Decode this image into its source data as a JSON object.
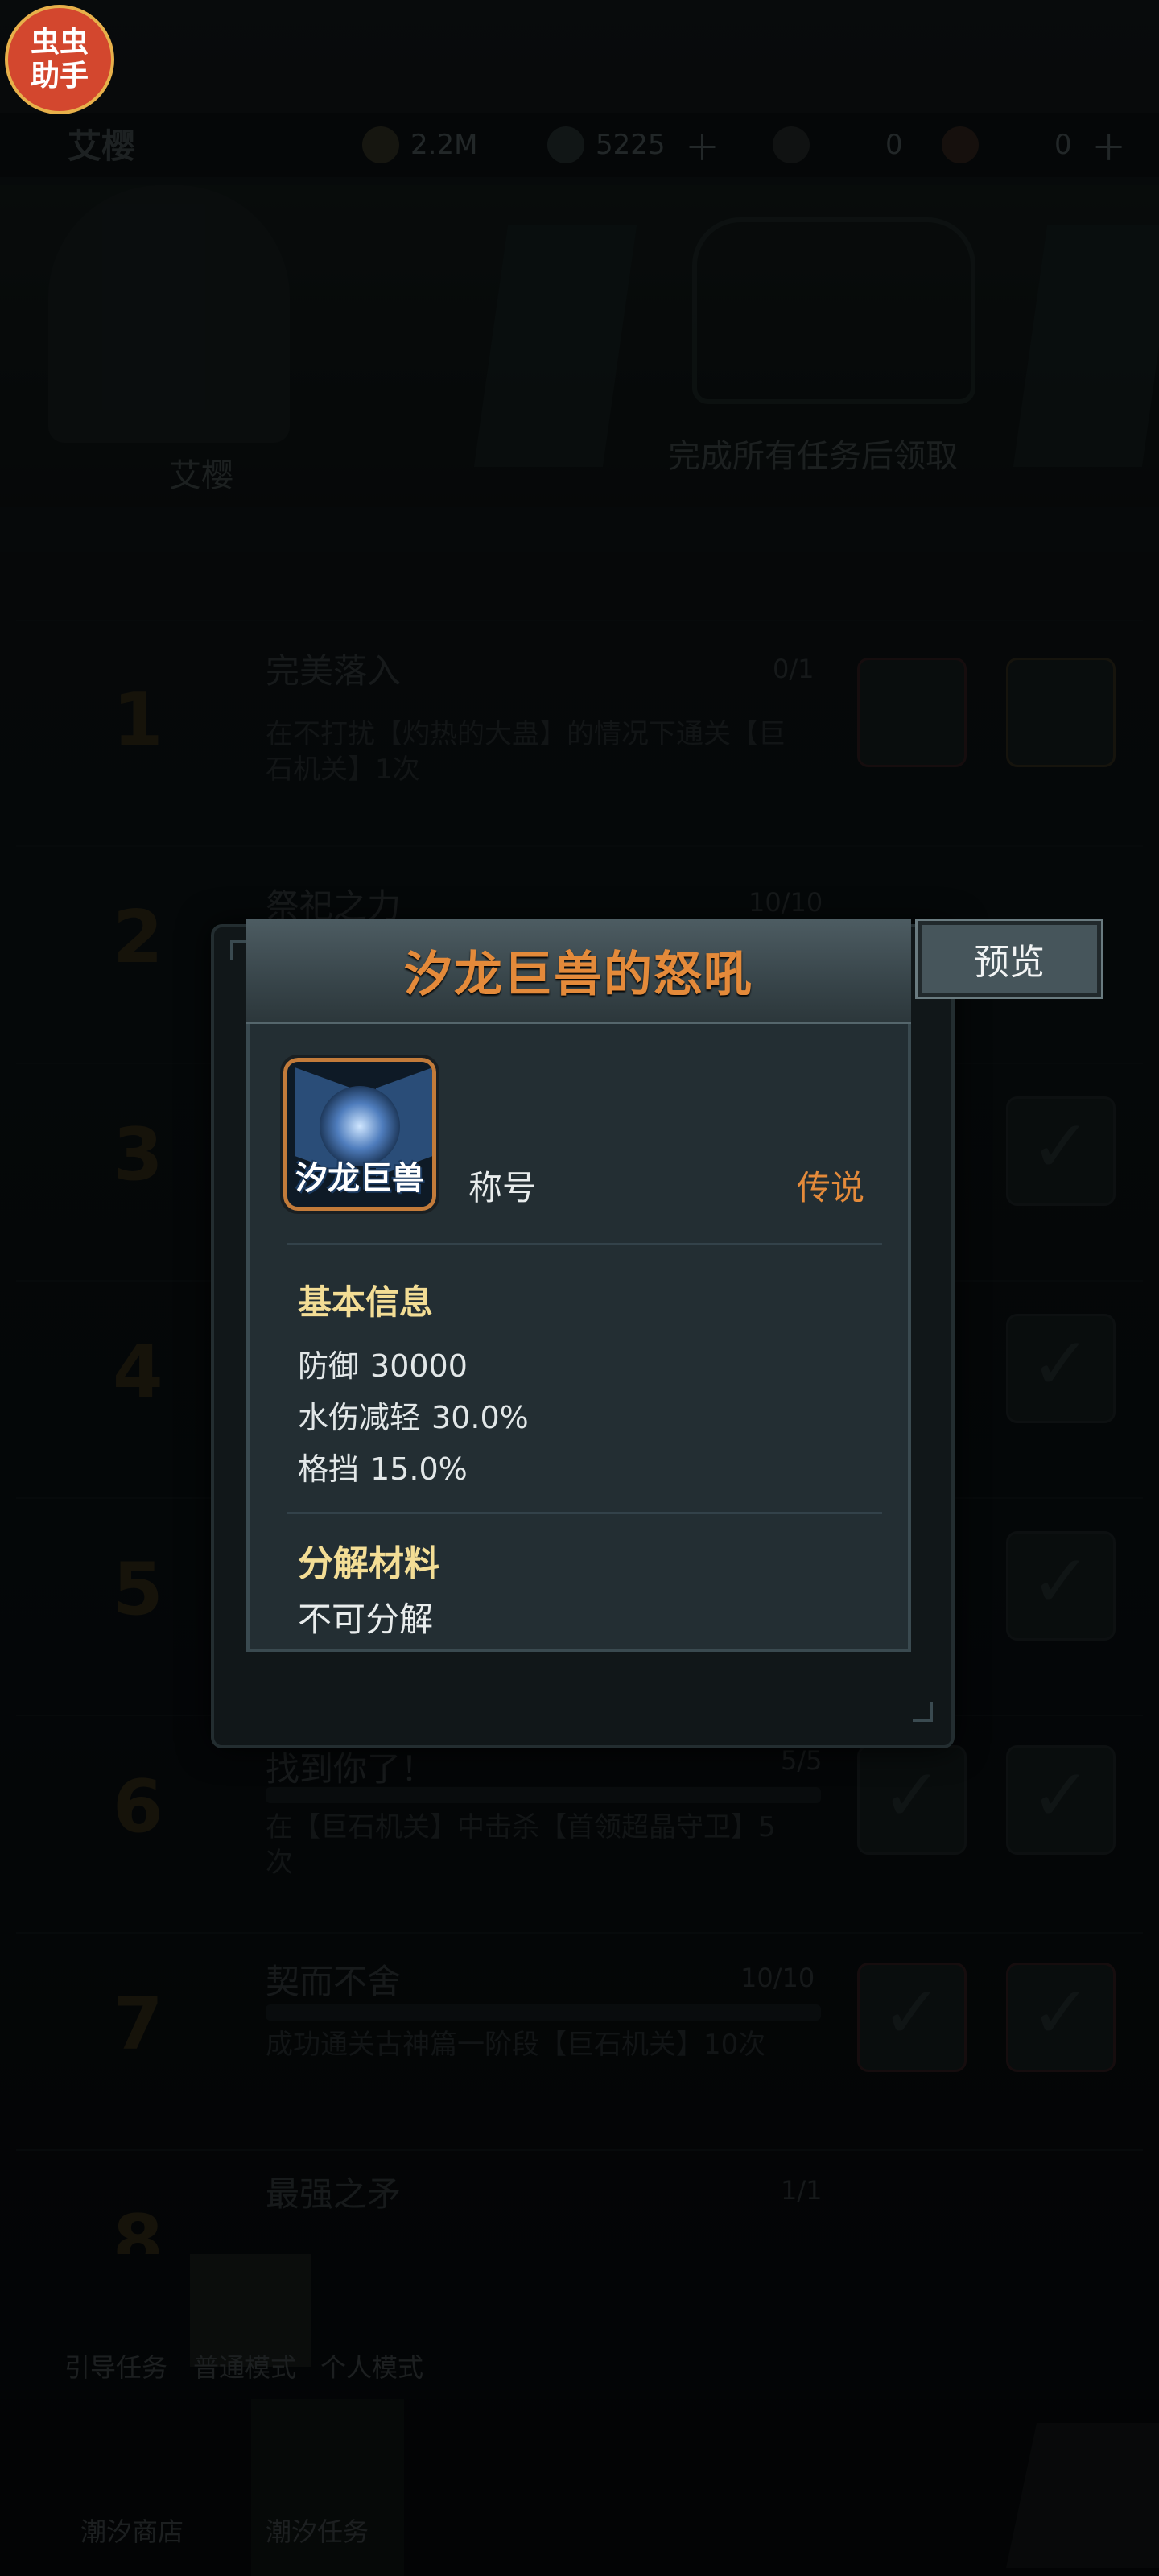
{
  "overlay_badge": {
    "label": "虫虫\n助手"
  },
  "background": {
    "player_name": "艾樱",
    "resources": [
      {
        "icon": "coin-icon",
        "value": "2.2M"
      },
      {
        "icon": "gem-icon",
        "value": "5225"
      },
      {
        "icon": "key-icon",
        "value": "0"
      },
      {
        "icon": "ticket-icon",
        "value": "0"
      }
    ],
    "character_name": "艾樱",
    "banner_text": "完成所有任务后领取",
    "tasks": [
      {
        "num": "1",
        "title": "完美落入",
        "count": "0/1",
        "desc": "在不打扰【灼热的大蛊】的情况下通关【巨石机关】1次"
      },
      {
        "num": "2",
        "title": "祭祀之力",
        "count": "10/10",
        "desc": ""
      },
      {
        "num": "3",
        "title": "",
        "count": "",
        "desc": ""
      },
      {
        "num": "4",
        "title": "",
        "count": "",
        "desc": ""
      },
      {
        "num": "5",
        "title": "",
        "count": "",
        "desc": ""
      },
      {
        "num": "6",
        "title": "找到你了！",
        "count": "5/5",
        "desc": "在【巨石机关】中击杀【首领超晶守卫】5次"
      },
      {
        "num": "7",
        "title": "契而不舍",
        "count": "10/10",
        "desc": "成功通关古神篇一阶段【巨石机关】10次"
      },
      {
        "num": "8",
        "title": "最强之矛",
        "count": "1/1",
        "desc": ""
      }
    ],
    "nav": [
      "引导任务",
      "普通模式",
      "个人模式"
    ],
    "bottom": [
      "潮汐商店",
      "潮汐任务"
    ]
  },
  "modal": {
    "title": "汐龙巨兽的怒吼",
    "preview_label": "预览",
    "icon_text": "汐龙巨兽",
    "item_type": "称号",
    "rarity": "传说",
    "basic_info": {
      "heading": "基本信息",
      "stats": [
        {
          "name": "防御",
          "value": "30000"
        },
        {
          "name": "水伤减轻",
          "value": "30.0%"
        },
        {
          "name": "格挡",
          "value": "15.0%"
        }
      ]
    },
    "materials": {
      "heading": "分解材料",
      "value": "不可分解"
    }
  },
  "colors": {
    "accent": "#e48a3a",
    "section": "#f3dd95",
    "panel": "#232e33"
  }
}
